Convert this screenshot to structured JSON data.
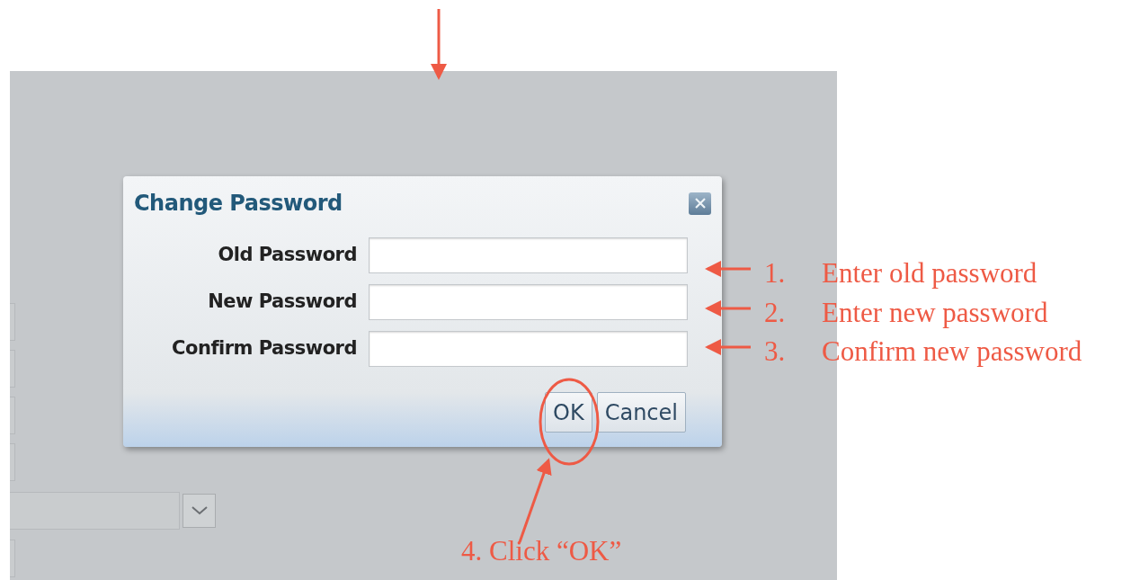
{
  "dialog": {
    "title": "Change Password",
    "fields": [
      {
        "label": "Old Password"
      },
      {
        "label": "New Password"
      },
      {
        "label": "Confirm Password"
      }
    ],
    "buttons": [
      "OK",
      "Cancel"
    ]
  },
  "annotations": [
    {
      "number": "1.",
      "text": "Enter old password"
    },
    {
      "number": "2.",
      "text": "Enter new password"
    },
    {
      "number": "3.",
      "text": "Confirm new password"
    }
  ],
  "callout": "4. Click “OK”"
}
